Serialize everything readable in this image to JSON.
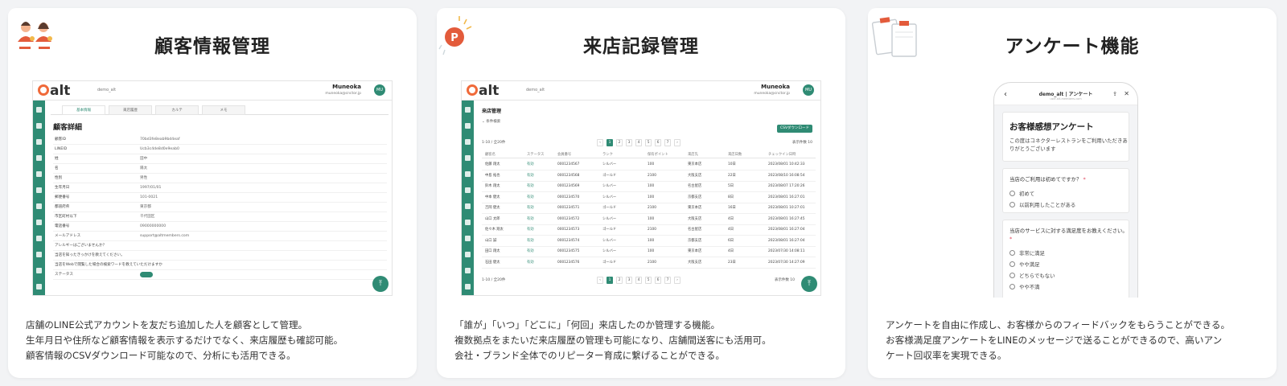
{
  "cards": [
    {
      "title": "顧客情報管理",
      "icon": "customer-people-icon",
      "description": [
        "店舗のLINE公式アカウントを友だち追加した人を顧客として管理。",
        "生年月日や住所など顧客情報を表示するだけでなく、来店履歴も確認可能。",
        "顧客情報のCSVダウンロード可能なので、分析にも活用できる。"
      ]
    },
    {
      "title": "来店記録管理",
      "icon": "point-badge-icon",
      "description": [
        "「誰が」「いつ」「どこに」「何回」来店したのか管理する機能。",
        "複数拠点をまたいだ来店履歴の管理も可能になり、店舗間送客にも活用可。",
        "会社・ブランド全体でのリピーター育成に繋げることができる。"
      ]
    },
    {
      "title": "アンケート機能",
      "icon": "clipboard-survey-icon",
      "description": [
        "アンケートを自由に作成し、お客様からのフィードバックをもらうことができる。",
        "お客様満足度アンケートをLINEのメッセージで送ることができるので、高いアン",
        "ケート回収率を実現できる。"
      ]
    }
  ],
  "app": {
    "logo": "alt",
    "tenant": "demo_alt",
    "user_name": "Muneoka",
    "user_email": "muneoka@cnctor.jp",
    "avatar": "MU"
  },
  "customer_detail": {
    "tabs": [
      "基本情報",
      "來店履歴",
      "カルテ",
      "メモ"
    ],
    "title": "顧客詳細",
    "rows": [
      {
        "label": "顧客ID",
        "value": "70bd3fe8eab9bd4eaf"
      },
      {
        "label": "LINEID",
        "value": "Ucb3c4de8d0e9eab0"
      },
      {
        "label": "姓",
        "value": "田中"
      },
      {
        "label": "名",
        "value": "陽太"
      },
      {
        "label": "性別",
        "value": "男性"
      },
      {
        "label": "生年月日",
        "value": "1997/01/01"
      },
      {
        "label": "郵便番号",
        "value": "101-0021"
      },
      {
        "label": "都道府県",
        "value": "東京都"
      },
      {
        "label": "市区町村以下",
        "value": "千代田区"
      },
      {
        "label": "電話番号",
        "value": "09000000000"
      },
      {
        "label": "メールアドレス",
        "value": "support@altmembers.com"
      },
      {
        "label": "アレルギーはございませんか？",
        "value": ""
      },
      {
        "label": "当店を知ったきっかけを教えてください。",
        "value": ""
      },
      {
        "label": "当店をWebで閲覧した場合の検索ワードを教えていただけますか",
        "value": ""
      },
      {
        "label": "ステータス",
        "value": ""
      }
    ]
  },
  "visit_records": {
    "title": "来店管理",
    "filter_label": "条件検索",
    "csv_button": "CSVダウンロード",
    "count": "1-10 / 全20件",
    "pages": [
      "1",
      "2",
      "3",
      "4",
      "5",
      "6",
      "7"
    ],
    "per_page": "表示件数 10",
    "columns": [
      "顧客名",
      "ステータス",
      "会員番号",
      "ランク",
      "保有ポイント",
      "来店先",
      "来店日数",
      "チェックイン日時"
    ],
    "rows": [
      [
        "佐藤 翔太",
        "有効",
        "0001234567",
        "シルバー",
        "100",
        "東京本店",
        "10日",
        "2023/08/01 10:42:33"
      ],
      [
        "中島 拓也",
        "有効",
        "0001234568",
        "ゴールド",
        "2100",
        "大阪支店",
        "22日",
        "2023/08/10 16:08:54"
      ],
      [
        "鈴木 翔太",
        "有効",
        "0001234569",
        "シルバー",
        "100",
        "名古屋店",
        "5日",
        "2023/08/07 17:20:26"
      ],
      [
        "中本 健太",
        "有効",
        "0001234570",
        "シルバー",
        "100",
        "京都支店",
        "8日",
        "2023/08/01 16:27:01"
      ],
      [
        "吉岡 健太",
        "有効",
        "0001234571",
        "ゴールド",
        "2100",
        "東京本店",
        "16日",
        "2023/08/01 10:27:01"
      ],
      [
        "山口 太郎",
        "有効",
        "0001234572",
        "シルバー",
        "100",
        "大阪支店",
        "4日",
        "2023/08/01 16:27:45"
      ],
      [
        "佐々木 翔太",
        "有効",
        "0001234573",
        "ゴールド",
        "2100",
        "名古屋店",
        "4日",
        "2023/08/01 16:27:04"
      ],
      [
        "山口 誠",
        "有効",
        "0001234574",
        "シルバー",
        "100",
        "京都支店",
        "6日",
        "2023/08/01 16:27:04"
      ],
      [
        "田口 翔太",
        "有効",
        "0001234575",
        "シルバー",
        "100",
        "東京本店",
        "4日",
        "2023/07/30 14:08:11"
      ],
      [
        "石田 健太",
        "有効",
        "0001234576",
        "ゴールド",
        "2100",
        "大阪支店",
        "23日",
        "2023/07/30 14:27:09"
      ]
    ]
  },
  "survey": {
    "header_title": "demo_alt | アンケート",
    "header_url": "user.alt-members.com",
    "title": "お客様感想アンケート",
    "intro": "この度はコネクターレストランをご利用いただきありがとうございます",
    "q1": "当店のご利用は初めてですか？",
    "q1_required": "*",
    "q1_options": [
      "初めて",
      "以前利用したことがある"
    ],
    "q2": "当店のサービスに対する満足度をお教えください。",
    "q2_required": "*",
    "q2_options": [
      "非常に満足",
      "やや満足",
      "どちらでもない",
      "やや不満"
    ]
  },
  "colors": {
    "brand_green": "#2f8b74",
    "logo_orange": "#f06a3a",
    "accent_red": "#e35b3b"
  }
}
